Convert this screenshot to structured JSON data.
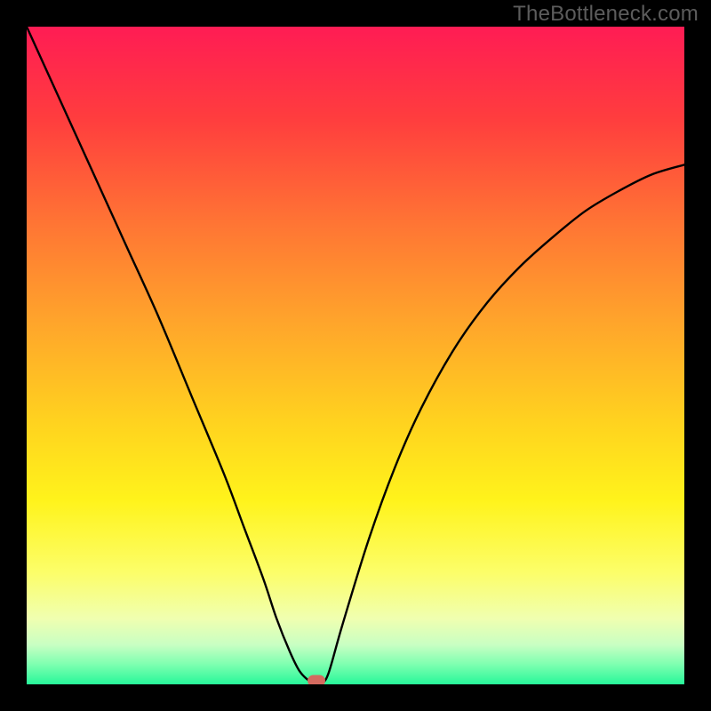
{
  "watermark": {
    "text": "TheBottleneck.com"
  },
  "chart_data": {
    "type": "line",
    "title": "",
    "xlabel": "",
    "ylabel": "",
    "xlim": [
      0,
      100
    ],
    "ylim": [
      0,
      100
    ],
    "grid": false,
    "legend": false,
    "background_gradient": {
      "direction": "vertical",
      "stops": [
        {
          "pos": 0.0,
          "color": "#ff1c54"
        },
        {
          "pos": 0.14,
          "color": "#ff3d3e"
        },
        {
          "pos": 0.3,
          "color": "#ff7534"
        },
        {
          "pos": 0.45,
          "color": "#ffa52b"
        },
        {
          "pos": 0.6,
          "color": "#ffd21f"
        },
        {
          "pos": 0.72,
          "color": "#fff31b"
        },
        {
          "pos": 0.83,
          "color": "#fcfe69"
        },
        {
          "pos": 0.9,
          "color": "#f0ffb0"
        },
        {
          "pos": 0.94,
          "color": "#c8ffc3"
        },
        {
          "pos": 0.97,
          "color": "#7dffb0"
        },
        {
          "pos": 1.0,
          "color": "#27f79a"
        }
      ]
    },
    "series": [
      {
        "name": "bottleneck-curve",
        "color": "#000000",
        "x": [
          0,
          5,
          10,
          15,
          20,
          25,
          30,
          33,
          36,
          38,
          40,
          41.5,
          43,
          44,
          45,
          46,
          48,
          52,
          56,
          60,
          65,
          70,
          75,
          80,
          85,
          90,
          95,
          100
        ],
        "y": [
          100,
          89,
          78,
          67,
          56,
          44,
          32,
          24,
          16,
          10,
          5,
          2,
          0.5,
          0.2,
          0.2,
          2,
          9,
          22,
          33,
          42,
          51,
          58,
          63.5,
          68,
          72,
          75,
          77.5,
          79
        ]
      }
    ],
    "marker": {
      "x": 44,
      "y": 0.5,
      "color": "#d46a5f"
    }
  }
}
